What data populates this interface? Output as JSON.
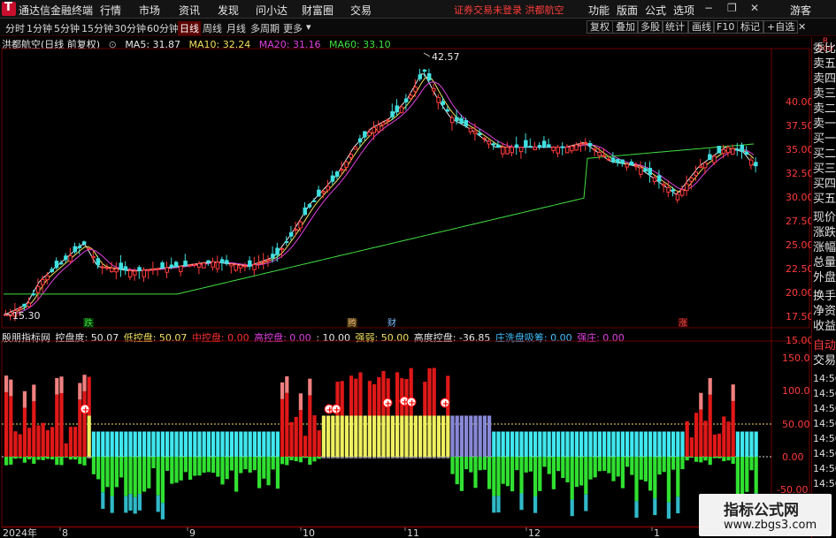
{
  "app": {
    "name": "通达信金融终端"
  },
  "menu": [
    "行情",
    "市场",
    "资讯",
    "发现",
    "问小达",
    "财富圈",
    "交易"
  ],
  "alert": "证券交易未登录  洪都航空",
  "right_menu": [
    "功能",
    "版面",
    "公式",
    "选项"
  ],
  "guest": "游客",
  "toolbar": {
    "periods": [
      "分时",
      "1分钟",
      "5分钟",
      "15分钟",
      "30分钟",
      "60分钟",
      "日线",
      "周线",
      "月线",
      "多周期",
      "更多"
    ],
    "active": "日线",
    "right_buttons": [
      "复权",
      "叠加",
      "多股",
      "统计",
      "画线",
      "F10",
      "标记",
      "+自选"
    ]
  },
  "price_info": {
    "stock": "洪都航空(日线 前复权)",
    "ma5_label": "MA5: 31.87",
    "ma10_label": "MA10: 32.24",
    "ma20_label": "MA20: 31.16",
    "ma60_label": "MA60: 33.10",
    "ma5_color": "#e8e8e8",
    "ma10_color": "#f0e060",
    "ma20_color": "#e040e0",
    "ma60_color": "#40e040"
  },
  "indicator_info": {
    "name": "殷朋指标网",
    "kong_label": "控盘度: 50.07",
    "low_label": "低控盘: 50.07",
    "mid_label": "中控盘: 0.00",
    "high_label": "高控盘: 0.00",
    "ten_label": ": 10.00",
    "strong_label": "强弱: 50.00",
    "degree_label": "高度控盘: -36.85",
    "wash_label": "庄洗盘吸筹: 0.00",
    "zhuang_label": "强庄: 0.00"
  },
  "price_axis": [
    "40.00",
    "37.50",
    "35.00",
    "32.50",
    "30.00",
    "27.50",
    "25.00",
    "22.50",
    "20.00",
    "17.50",
    "15.00"
  ],
  "ind_axis": [
    "150.0",
    "100.0",
    "50.00",
    "0.00",
    "-50.00"
  ],
  "annotations": {
    "high": "42.57",
    "low": "15.30"
  },
  "markers": {
    "m1": "跌",
    "m2": "腾",
    "m3": "财",
    "m4": "涨"
  },
  "x_axis": [
    "2024年",
    "8",
    "9",
    "10",
    "11",
    "12",
    "1"
  ],
  "right_panel": {
    "r_label": "R",
    "r_value": "500",
    "items": [
      "委比",
      "卖五",
      "卖四",
      "卖三",
      "卖二",
      "卖一",
      "买一",
      "买二",
      "买三",
      "买四",
      "买五",
      "现价",
      "涨跌",
      "涨幅",
      "总量",
      "外盘",
      "换手",
      "净资",
      "收益"
    ],
    "auto_label": "自动",
    "trade_label": "交易",
    "times": [
      "14:56",
      "14:56",
      "14:56",
      "14:56",
      "14:56",
      "14:56",
      "14:56",
      "14:56"
    ]
  },
  "watermark": {
    "line1": "指标公式网",
    "line2": "www.zbgs3.com"
  }
}
